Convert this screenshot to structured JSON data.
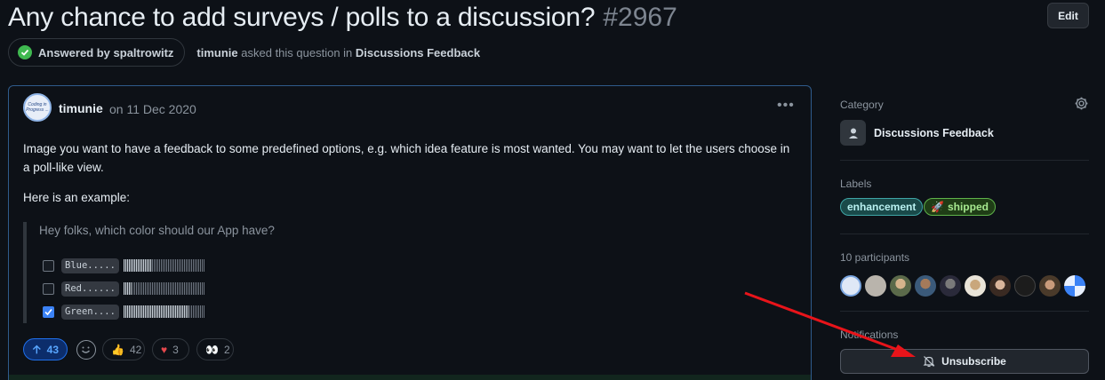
{
  "header": {
    "title": "Any chance to add surveys / polls to a discussion?",
    "number": "#2967",
    "edit_label": "Edit"
  },
  "meta": {
    "answered_badge": "Answered by spaltrowitz",
    "author": "timunie",
    "asked_text": " asked this question in ",
    "category": "Discussions Feedback"
  },
  "post": {
    "author": "timunie",
    "avatar_text": "Coding in Progress ...",
    "date": "on 11 Dec 2020",
    "paragraph1": "Image you want to have a feedback to some predefined options, e.g. which idea feature is most wanted. You may want to let the users choose in a poll-like view.",
    "paragraph2": "Here is an example:",
    "quote": "Hey folks, which color should our App have?",
    "options": [
      {
        "label": "Blue.....",
        "checked": false,
        "fill": 0.35
      },
      {
        "label": "Red......",
        "checked": false,
        "fill": 0.1
      },
      {
        "label": "Green....",
        "checked": true,
        "fill": 0.8
      }
    ]
  },
  "reactions": {
    "upvotes": "43",
    "thumbs_up": "42",
    "heart": "3",
    "eyes": "2"
  },
  "sidebar": {
    "category_label": "Category",
    "category_name": "Discussions Feedback",
    "labels_label": "Labels",
    "labels": [
      "enhancement",
      "shipped"
    ],
    "participants_label": "10 participants",
    "notifications_label": "Notifications",
    "unsubscribe_label": "Unsubscribe"
  },
  "colors": {
    "accent": "#1f6feb",
    "answered": "#3fb950",
    "annotation_arrow": "#e8141a"
  }
}
